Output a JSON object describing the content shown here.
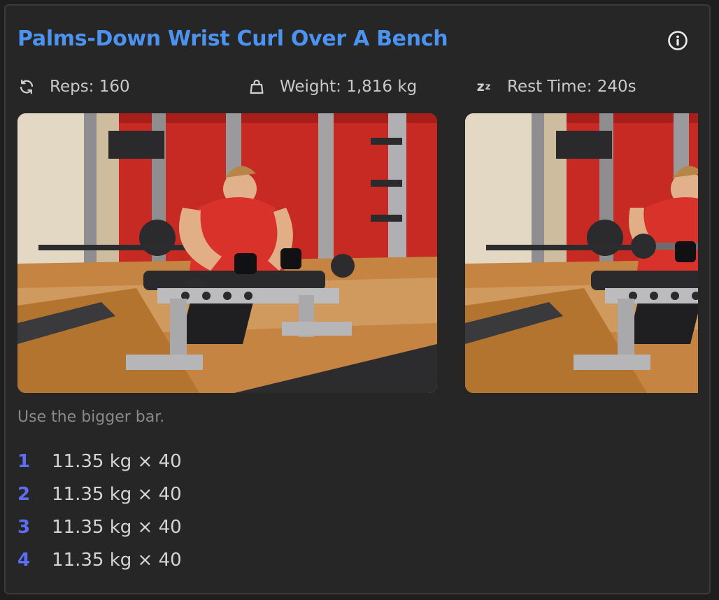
{
  "exercise": {
    "title": "Palms-Down Wrist Curl Over A Bench",
    "info_icon": "info-circle-icon"
  },
  "stats": {
    "reps": {
      "icon": "repeat-icon",
      "label": "Reps: 160"
    },
    "weight": {
      "icon": "weight-icon",
      "label": "Weight: 1,816 kg"
    },
    "rest": {
      "icon": "sleep-zz-icon",
      "label": "Rest Time: 240s"
    }
  },
  "images": [
    {
      "name": "exercise-photo-start"
    },
    {
      "name": "exercise-photo-end"
    }
  ],
  "note": "Use the bigger bar.",
  "sets": [
    {
      "number": "1",
      "detail": "11.35 kg × 40"
    },
    {
      "number": "2",
      "detail": "11.35 kg × 40"
    },
    {
      "number": "3",
      "detail": "11.35 kg × 40"
    },
    {
      "number": "4",
      "detail": "11.35 kg × 40"
    }
  ],
  "colors": {
    "title": "#4c93f0",
    "set_number": "#5b6ff0",
    "card_background": "#262627",
    "page_background": "#1e1e1f"
  }
}
